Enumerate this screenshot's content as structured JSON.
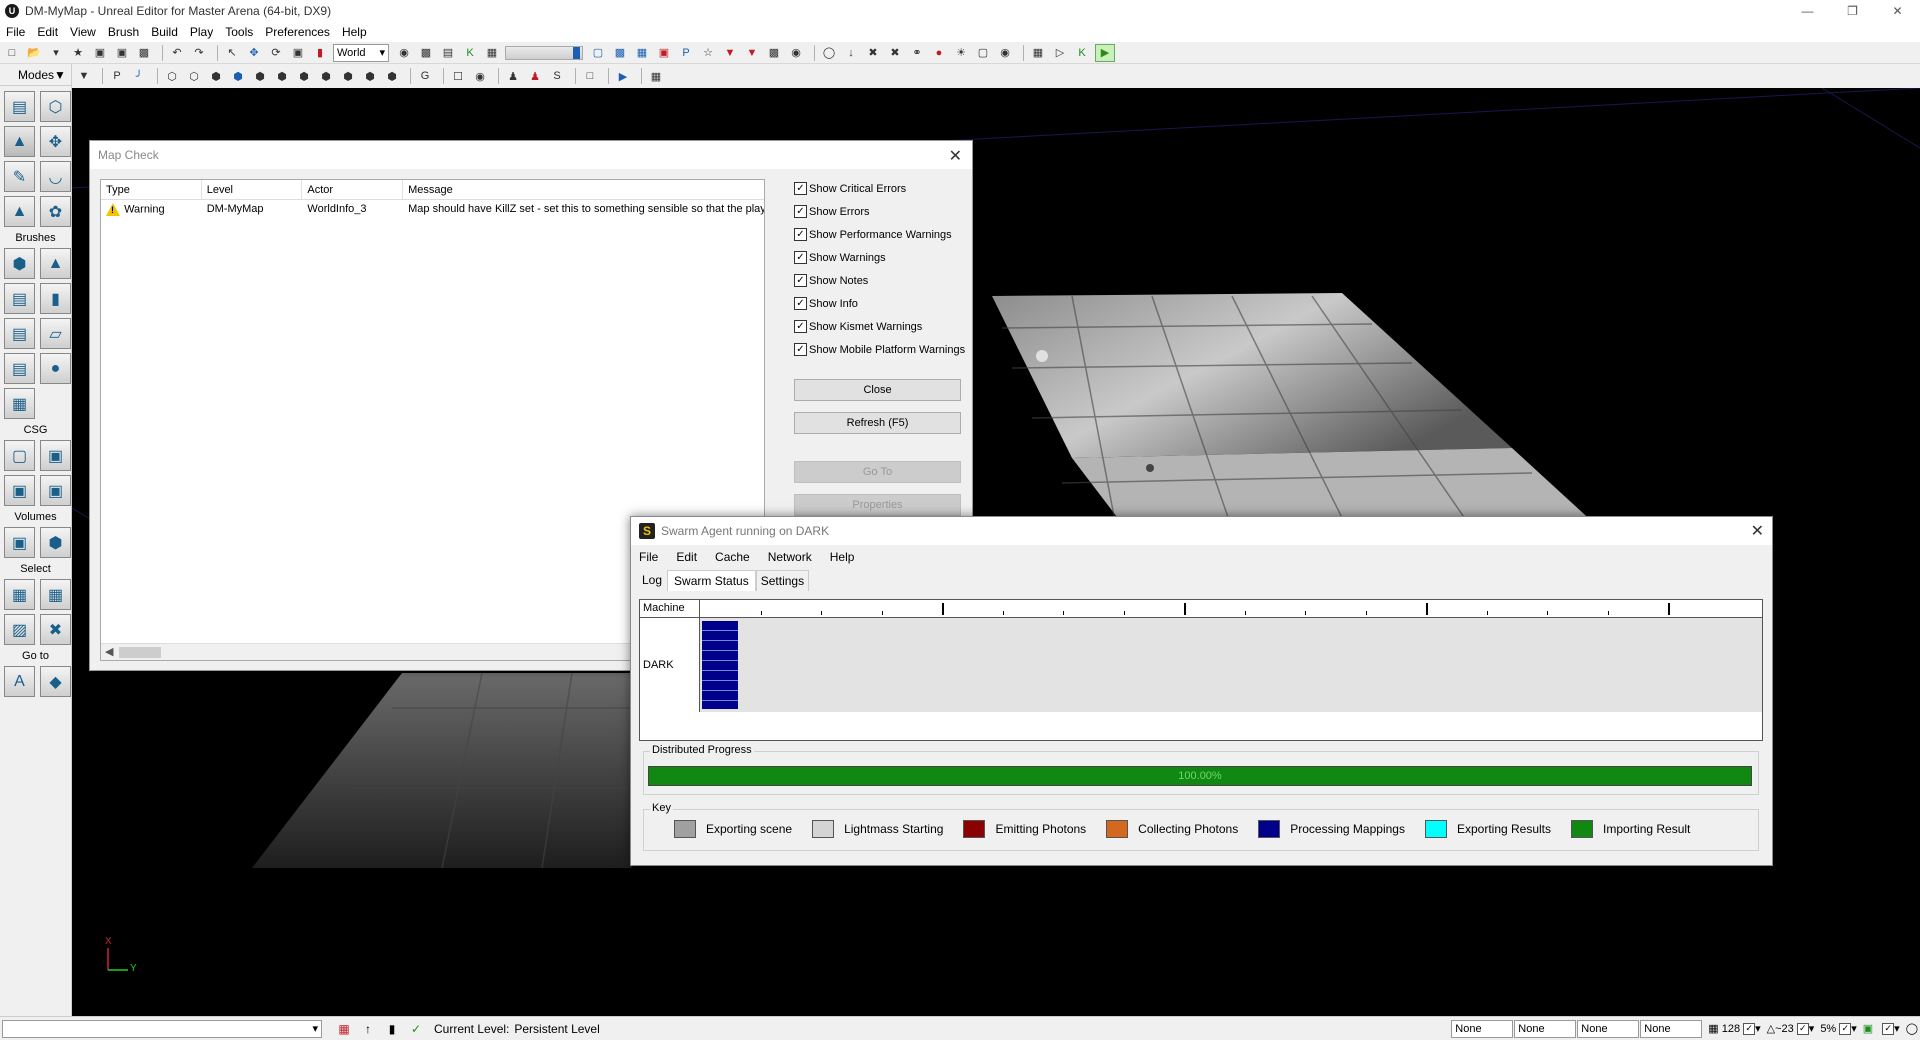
{
  "window": {
    "title": "DM-MyMap - Unreal Editor for Master Arena (64-bit, DX9)"
  },
  "menu": [
    "File",
    "Edit",
    "View",
    "Brush",
    "Build",
    "Play",
    "Tools",
    "Preferences",
    "Help"
  ],
  "toolbar": {
    "coord_system": "World"
  },
  "modes": {
    "title": "Modes",
    "sections": {
      "brushes": "Brushes",
      "csg": "CSG",
      "volumes": "Volumes",
      "select": "Select",
      "goto": "Go to"
    }
  },
  "viewport": {
    "axis_x": "X",
    "axis_y": "Y"
  },
  "statusbar": {
    "combo_value": "",
    "current_level_label": "Current Level:",
    "current_level_value": "Persistent Level",
    "fields": [
      "None",
      "None",
      "None",
      "None"
    ],
    "grid": "128",
    "rotation": "~23",
    "scale": "5%"
  },
  "mapcheck": {
    "title": "Map Check",
    "columns": [
      "Type",
      "Level",
      "Actor",
      "Message"
    ],
    "rows": [
      {
        "type": "Warning",
        "level": "DM-MyMap",
        "actor": "WorldInfo_3",
        "message": "Map should have KillZ set - set this to something sensible so that the player c"
      }
    ],
    "options": [
      "Show Critical Errors",
      "Show Errors",
      "Show Performance Warnings",
      "Show Warnings",
      "Show Notes",
      "Show Info",
      "Show Kismet Warnings",
      "Show Mobile Platform Warnings"
    ],
    "buttons": {
      "close": "Close",
      "refresh": "Refresh (F5)",
      "goto": "Go To",
      "properties": "Properties"
    }
  },
  "swarm": {
    "title": "Swarm Agent running on DARK",
    "logo": "S",
    "menu": [
      "File",
      "Edit",
      "Cache",
      "Network",
      "Help"
    ],
    "tabs": [
      "Log",
      "Swarm Status",
      "Settings"
    ],
    "active_tab": "Swarm Status",
    "machine_header": "Machine",
    "machines": [
      "DARK"
    ],
    "progress_title": "Distributed Progress",
    "progress_value": 1.0,
    "progress_text": "100.00%",
    "key_title": "Key",
    "key": [
      {
        "label": "Exporting scene",
        "color": "#a0a0a0"
      },
      {
        "label": "Lightmass Starting",
        "color": "#d4d4d4"
      },
      {
        "label": "Emitting Photons",
        "color": "#8b0000"
      },
      {
        "label": "Collecting Photons",
        "color": "#d2691e"
      },
      {
        "label": "Processing Mappings",
        "color": "#00008b"
      },
      {
        "label": "Exporting Results",
        "color": "#00ffff"
      },
      {
        "label": "Importing Result",
        "color": "#118811"
      }
    ]
  }
}
